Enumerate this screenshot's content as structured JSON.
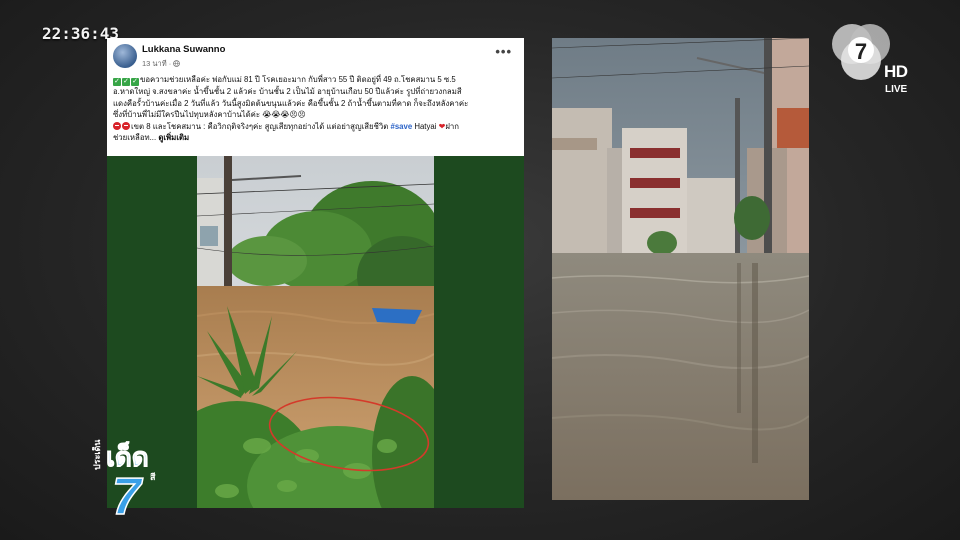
{
  "overlay": {
    "clock": "22:36:43",
    "channel_hd": "HD",
    "channel_live": "LIVE",
    "logo_text": "7",
    "program_text_top": "ประเด็น",
    "program_text_mid": "เด็ด",
    "program_text_suffix": "สี"
  },
  "post": {
    "author": "Lukkana Suwanno",
    "time": "13 นาที · ",
    "text_line1": "ขอความช่วยเหลือค่ะ พ่อกับแม่ 81 ปี โรคเยอะมาก กับพี่สาว 55 ปี ติดอยู่ที่ 49 ถ.โชคสมาน 5 ซ.5",
    "text_line2": "อ.หาดใหญ่ จ.สงขลาค่ะ น้ำขึ้นชั้น 2 แล้วค่ะ บ้านชั้น 2 เป็นไม้ อายุบ้านเกือบ 50 ปีแล้วค่ะ รูปที่ถ่ายวงกลมสี",
    "text_line3": "แดงคือรั้วบ้านค่ะเมื่อ 2 วันที่แล้ว วันนี้สูงมิดต้นขนุนแล้วค่ะ คือขึ้นชั้น 2 ถ้าน้ำขึ้นตามที่คาด ก็จะถึงหลังคาค่ะ",
    "text_line4": "ซึ่งที่บ้านพี่ไม่มีใครปีนไปทุบหลังคาบ้านได้ค่ะ 😭😭😭😣😣",
    "text_line5a": "เขต 8 และโชคสมาน : คือวิกฤติจริงๆค่ะ สูญเสียทุกอย่างได้ แต่อย่าสูญเสียชีวิต ",
    "hashtag": "#save",
    "place": " Hatyai ",
    "text_line5b": "ฝาก",
    "text_line6": "ช่วยเหลือท... ",
    "see_more": "ดูเพิ่มเติม"
  },
  "colors": {
    "post_bg": "#1d4a1f",
    "flood_water": "#b08354",
    "channel_accent": "#3aa0e8"
  }
}
